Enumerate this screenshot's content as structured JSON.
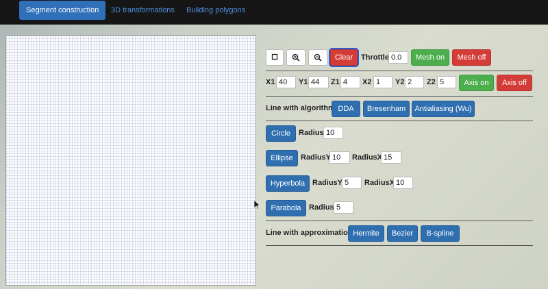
{
  "nav": {
    "tabs": [
      {
        "label": "Segment construction",
        "active": true
      },
      {
        "label": "3D transformations",
        "active": false
      },
      {
        "label": "Building polygons",
        "active": false
      }
    ]
  },
  "toolbar": {
    "square_icon": "square-icon",
    "zoom_in_icon": "zoom-in-icon",
    "zoom_out_icon": "zoom-out-icon",
    "clear_label": "Clear",
    "throttle_label": "Throttle",
    "throttle_value": "0.0",
    "mesh_on_label": "Mesh on",
    "mesh_off_label": "Mesh off"
  },
  "coords": {
    "x1_label": "X1",
    "x1_value": "40",
    "y1_label": "Y1",
    "y1_value": "44",
    "z1_label": "Z1",
    "z1_value": "4",
    "x2_label": "X2",
    "x2_value": "1",
    "y2_label": "Y2",
    "y2_value": "2",
    "z2_label": "Z2",
    "z2_value": "5",
    "axis_on_label": "Axis on",
    "axis_off_label": "Axis off"
  },
  "line_algorithm": {
    "label": "Line with algorithm",
    "dda": "DDA",
    "bresenham": "Bresenham",
    "antialiasing": "Antialiasing (Wu)"
  },
  "curves": {
    "circle": {
      "button": "Circle",
      "radius_label": "Radius",
      "radius_value": "10"
    },
    "ellipse": {
      "button": "Ellipse",
      "radius_y_label": "RadiusY",
      "radius_y_value": "10",
      "radius_x_label": "RadiusX",
      "radius_x_value": "15"
    },
    "hyperbola": {
      "button": "Hyperbola",
      "radius_y_label": "RadiusY",
      "radius_y_value": "5",
      "radius_x_label": "RadiusX",
      "radius_x_value": "10"
    },
    "parabola": {
      "button": "Parabola",
      "radius_label": "Radius",
      "radius_value": "5"
    }
  },
  "approximation": {
    "label": "Line with approximation",
    "hermite": "Hermite",
    "bezier": "Bezier",
    "bspline": "B-spline"
  },
  "colors": {
    "accent_blue": "#2f6fb0",
    "green": "#4cae4c",
    "red": "#d43d37",
    "navbar": "#161616"
  }
}
